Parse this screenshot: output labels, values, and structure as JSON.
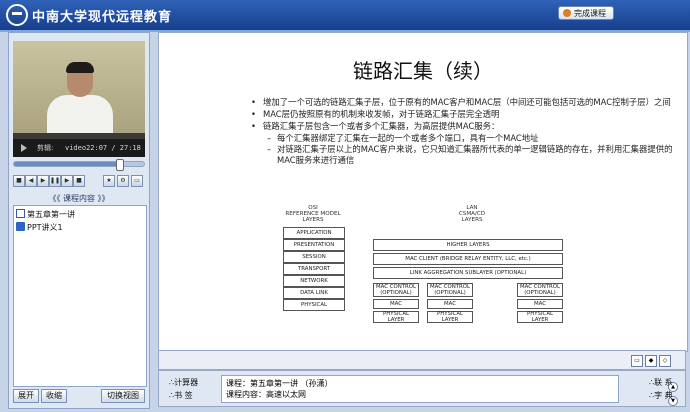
{
  "app": {
    "brand": "中南大学现代远程教育",
    "finish_label": "完成课程"
  },
  "player": {
    "cut_label": "剪辑:",
    "time": "video22:07 / 27:18",
    "progress": 0.81
  },
  "controls": [
    {
      "name": "stop-button",
      "glyph": "■"
    },
    {
      "name": "prev-button",
      "glyph": "◀"
    },
    {
      "name": "play-button",
      "glyph": "▶"
    },
    {
      "name": "pause-button",
      "glyph": "❚❚"
    },
    {
      "name": "next-button",
      "glyph": "▶"
    },
    {
      "name": "end-button",
      "glyph": "■"
    },
    {
      "name": "star-button",
      "glyph": "★"
    },
    {
      "name": "settings-button",
      "glyph": "⚙"
    },
    {
      "name": "fullscreen-button",
      "glyph": "▭"
    }
  ],
  "section": {
    "label": "《《 课程内容 》》"
  },
  "tree": {
    "item1": "第五章第一讲",
    "item2": "PPT讲义1"
  },
  "left_buttons": {
    "expand": "展开",
    "collapse": "收缩",
    "switch": "切换视图"
  },
  "slide": {
    "title": "链路汇集（续）",
    "b1": "增加了一个可选的链路汇集子层，位于原有的MAC客户和MAC层（中间还可能包括可选的MAC控制子层）之间",
    "b2": "MAC层仍按照原有的机制来收发帧，对于链路汇集子层完全透明",
    "b3": "链路汇集子层包含一个或者多个汇集器，为高层提供MAC服务：",
    "s1": "每个汇集器绑定了汇集在一起的一个或者多个端口，具有一个MAC地址",
    "s2": "对链路汇集子层以上的MAC客户来说，它只知道汇集器所代表的单一逻辑链路的存在，并利用汇集器提供的MAC服务来进行通信"
  },
  "diagram": {
    "osi_title": "OSI\nREFERENCE MODEL\nLAYERS",
    "lan_title": "LAN\nCSMA/CD\nLAYERS",
    "osi_layers": [
      "APPLICATION",
      "PRESENTATION",
      "SESSION",
      "TRANSPORT",
      "NETWORK",
      "DATA LINK",
      "PHYSICAL"
    ],
    "higher": "HIGHER LAYERS",
    "mac_client": "MAC CLIENT (BRIDGE RELAY ENTITY, LLC, etc.)",
    "lag": "LINK AGGREGATION SUBLAYER (OPTIONAL)",
    "mac_control": "MAC CONTROL\n(OPTIONAL)",
    "mac": "MAC",
    "phy": "PHYSICAL\nLAYER"
  },
  "bottom": {
    "calc": "∴计算器",
    "book": "∴书  签",
    "course_line": "课程：第五章第一讲 （孙潇）",
    "content_line": "课程内容：高速以太网",
    "contact": "∴联  系",
    "dict": "∴字  典"
  }
}
